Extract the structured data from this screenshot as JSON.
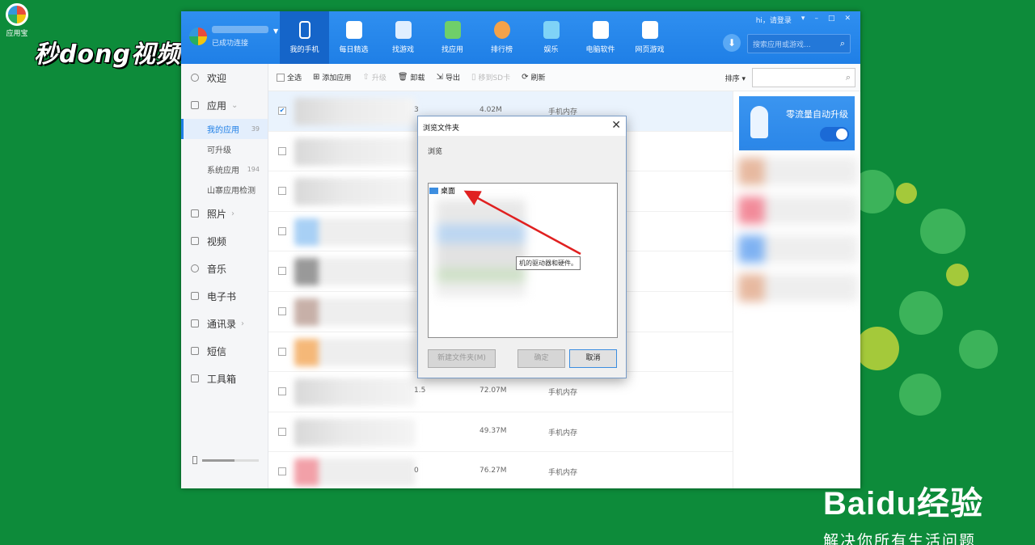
{
  "desktop": {
    "icon_label": "应用宝",
    "watermark": "秒dong视频",
    "baidu_brand": "Baidu经验",
    "baidu_slogan": "解决你所有生活问题"
  },
  "header": {
    "connection_status": "已成功连接",
    "nav": [
      {
        "label": "我的手机",
        "icon": "phone-icon"
      },
      {
        "label": "每日精选",
        "icon": "calendar-icon"
      },
      {
        "label": "找游戏",
        "icon": "gamepad-icon"
      },
      {
        "label": "找应用",
        "icon": "app-bag-icon"
      },
      {
        "label": "排行榜",
        "icon": "medal-icon"
      },
      {
        "label": "娱乐",
        "icon": "entertainment-icon"
      },
      {
        "label": "电脑软件",
        "icon": "monitor-icon"
      },
      {
        "label": "网页游戏",
        "icon": "web-game-icon"
      }
    ],
    "login": "hi，请登录",
    "search_placeholder": "搜索应用或游戏..."
  },
  "sidebar": {
    "items": [
      {
        "label": "欢迎"
      },
      {
        "label": "应用"
      },
      {
        "label": "照片"
      },
      {
        "label": "视频"
      },
      {
        "label": "音乐"
      },
      {
        "label": "电子书"
      },
      {
        "label": "通讯录"
      },
      {
        "label": "短信"
      },
      {
        "label": "工具箱"
      }
    ],
    "sub": [
      {
        "label": "我的应用",
        "count": "39"
      },
      {
        "label": "可升级",
        "count": ""
      },
      {
        "label": "系统应用",
        "count": "194"
      },
      {
        "label": "山寨应用检测",
        "count": ""
      }
    ]
  },
  "toolbar": {
    "select_all": "全选",
    "add_app": "添加应用",
    "upgrade": "升级",
    "uninstall": "卸载",
    "export": "导出",
    "move_sd": "移到SD卡",
    "refresh": "刷新",
    "sort": "排序"
  },
  "rows": [
    {
      "ver": "3",
      "size": "4.02M",
      "loc": "手机内存"
    },
    {
      "ver": "",
      "size": "",
      "loc": ""
    },
    {
      "ver": "",
      "size": "",
      "loc": ""
    },
    {
      "ver": "",
      "size": "",
      "loc": ""
    },
    {
      "ver": "",
      "size": "",
      "loc": ""
    },
    {
      "ver": "",
      "size": "",
      "loc": ""
    },
    {
      "ver": "",
      "size": "",
      "loc": ""
    },
    {
      "ver": "1.5",
      "size": "72.07M",
      "loc": "手机内存"
    },
    {
      "ver": "",
      "size": "49.37M",
      "loc": "手机内存"
    },
    {
      "ver": "0",
      "size": "76.27M",
      "loc": "手机内存"
    }
  ],
  "promo": {
    "title": "零流量自动升级"
  },
  "dialog": {
    "title": "浏览文件夹",
    "hint": "浏览",
    "tree_root": "桌面",
    "tooltip": "机的驱动器和硬件。",
    "new_folder": "新建文件夹(M)",
    "ok": "确定",
    "cancel": "取消"
  },
  "colors": {
    "accent": "#1f7fe6",
    "desktop": "#0d8b3a",
    "arrow": "#e02020"
  }
}
